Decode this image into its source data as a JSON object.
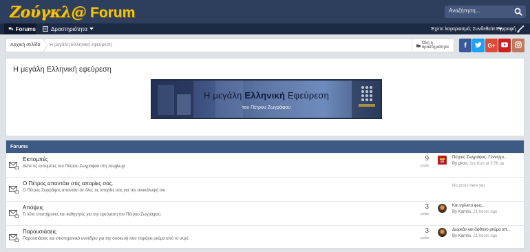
{
  "header": {
    "logo_main": "Ζούγκλ@",
    "logo_forum": "Forum",
    "search_placeholder": "Αναζήτηση..."
  },
  "nav": {
    "forums": "Forums",
    "activity": "Δραστηριότητα",
    "account": "Έχετε λογαριασμό; Συνδεθείτε",
    "register": "Εγγραφή"
  },
  "breadcrumb": {
    "home": "Αρχική σελίδα",
    "current": "Η μεγάλη Ελληνική εφεύρεση",
    "all_activity": "Όλη η δραστηριότητα"
  },
  "social": [
    {
      "name": "facebook",
      "glyph": "f",
      "color": "#3b5998"
    },
    {
      "name": "twitter",
      "glyph": "t",
      "color": "#1da1f2"
    },
    {
      "name": "google-plus",
      "glyph": "G+",
      "color": "#dd4b39"
    },
    {
      "name": "youtube",
      "glyph": "▶",
      "color": "#cd201f"
    },
    {
      "name": "instagram",
      "glyph": "◎",
      "color": "#c0795f"
    }
  ],
  "page": {
    "title": "Η μεγάλη Ελληνική εφεύρεση",
    "banner_pre": "Η μεγάλη ",
    "banner_bold": "Ελληνική",
    "banner_post": " Εφεύρεση",
    "banner_sub": "του Πέτρου Ζωγράφου"
  },
  "forums": {
    "header": "Forums",
    "rows": [
      {
        "title": "Εκπομπές",
        "desc": "Δείτε τις εκπομπές του Πέτρου Ζωγράφου στη zougla.gr",
        "count": "9",
        "posts_label": "posts",
        "last_title": "Πέτρος Ζωγράφος: Γεννήτρι...",
        "last_by": "By gkon,",
        "last_time": "Δευτέρα at 3:58 μμ"
      },
      {
        "title": "Ο Πέτρος απαντάει στις απορίες σας.",
        "desc": "Ο Πέτρος Ζωγράφος απαντάει σε όλες τις απορίες σας για την ανακάλυψή του.",
        "no_posts": "No posts here yet"
      },
      {
        "title": "Απόψεις",
        "desc": "Τι λένε επιστήμονες και καθηγητές για την εφεύρεση του Πέτρου Ζωγράφου.",
        "count": "3",
        "posts_label": "posts",
        "last_title": "Και εγένετο φως...",
        "last_by": "By Kamilo,",
        "last_time": "21 hours ago"
      },
      {
        "title": "Παρουσιάσεις",
        "desc": "Παρουσιάσεις και επιστημονικό συνέδριο για την συσκευή που παράγει ρεύμα από το νερό.",
        "count": "3",
        "posts_label": "posts",
        "last_title": "Δωρεάν και άφθονο ρεύμα απ...",
        "last_by": "By Kamilo,",
        "last_time": "21 hours ago"
      }
    ]
  },
  "colors": {
    "header_bg": "#2e3f5e",
    "nav_bg": "#1c2a44",
    "forums_header_bg": "#3d5a84",
    "logo": "#f0c419"
  }
}
